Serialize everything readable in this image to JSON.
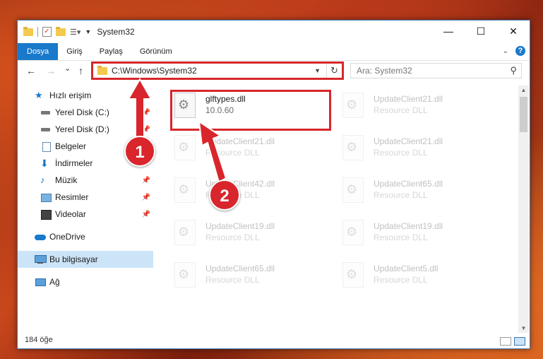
{
  "window": {
    "title": "System32",
    "controls": {
      "minimize": "—",
      "maximize": "☐",
      "close": "✕"
    }
  },
  "ribbon": {
    "tabs": [
      "Dosya",
      "Giriş",
      "Paylaş",
      "Görünüm"
    ],
    "active_tab": "Dosya",
    "help": "?"
  },
  "navigation": {
    "back": "←",
    "forward": "→",
    "recent": "⌄",
    "up": "↑",
    "address": "C:\\Windows\\System32",
    "refresh": "↻",
    "search_placeholder": "Ara: System32"
  },
  "sidebar": {
    "items": [
      {
        "label": "Hızlı erişim",
        "icon": "star-icon",
        "pinned": false
      },
      {
        "label": "Yerel Disk (C:)",
        "icon": "drive-icon",
        "pinned": true
      },
      {
        "label": "Yerel Disk (D:)",
        "icon": "drive-icon",
        "pinned": true
      },
      {
        "label": "Belgeler",
        "icon": "documents-icon",
        "pinned": true
      },
      {
        "label": "İndirmeler",
        "icon": "download-icon",
        "pinned": true
      },
      {
        "label": "Müzik",
        "icon": "music-icon",
        "pinned": true
      },
      {
        "label": "Resimler",
        "icon": "pictures-icon",
        "pinned": true
      },
      {
        "label": "Videolar",
        "icon": "videos-icon",
        "pinned": true
      },
      {
        "label": "OneDrive",
        "icon": "cloud-icon",
        "pinned": false
      },
      {
        "label": "Bu bilgisayar",
        "icon": "computer-icon",
        "pinned": false,
        "selected": true
      },
      {
        "label": "Ağ",
        "icon": "network-icon",
        "pinned": false
      }
    ]
  },
  "files": [
    {
      "name": "glftypes.dll",
      "detail": "10.0.60",
      "highlighted": true
    },
    {
      "name": "UpdateClient21.dll",
      "detail": "Resource DLL"
    },
    {
      "name": "UpdateClient21.dll",
      "detail": "Resource DLL"
    },
    {
      "name": "UpdateClient21.dll",
      "detail": "Resource DLL"
    },
    {
      "name": "UpdateClient42.dll",
      "detail": "Resource DLL"
    },
    {
      "name": "UpdateClient65.dll",
      "detail": "Resource DLL"
    },
    {
      "name": "UpdateClient19.dll",
      "detail": "Resource DLL"
    },
    {
      "name": "UpdateClient19.dll",
      "detail": "Resource DLL"
    },
    {
      "name": "UpdateClient65.dll",
      "detail": "Resource DLL"
    },
    {
      "name": "UpdateClient5.dll",
      "detail": "Resource DLL"
    }
  ],
  "status": {
    "item_count": "184 öğe"
  },
  "callouts": [
    "1",
    "2"
  ],
  "colors": {
    "accent": "#1979ca",
    "highlight_red": "#d8262c",
    "selected_bg": "#cce4f7"
  }
}
